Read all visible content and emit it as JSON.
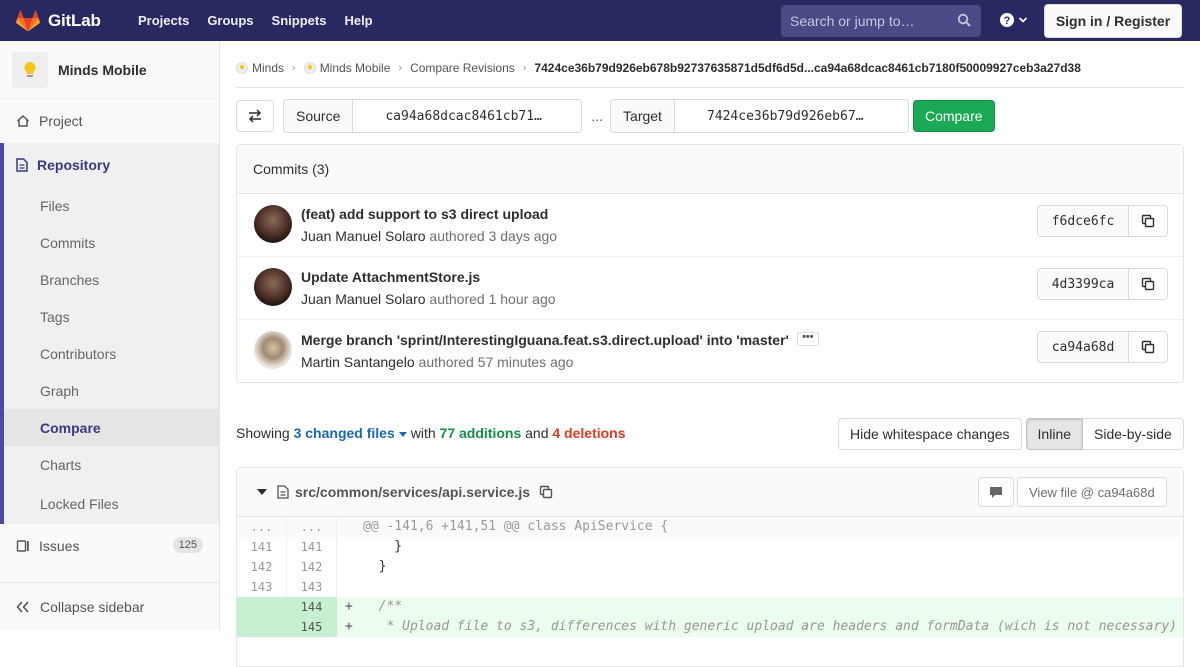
{
  "topbar": {
    "brand": "GitLab",
    "nav": [
      "Projects",
      "Groups",
      "Snippets",
      "Help"
    ],
    "search_placeholder": "Search or jump to…",
    "signin_label": "Sign in / Register",
    "brand_color": "#292961"
  },
  "sidebar": {
    "project_name": "Minds Mobile",
    "project_label": "Project",
    "repository_label": "Repository",
    "repo_items": [
      "Files",
      "Commits",
      "Branches",
      "Tags",
      "Contributors",
      "Graph",
      "Compare",
      "Charts",
      "Locked Files"
    ],
    "active_item": "Compare",
    "issues_label": "Issues",
    "issues_count": "125",
    "collapse_label": "Collapse sidebar"
  },
  "breadcrumb": {
    "items": [
      "Minds",
      "Minds Mobile",
      "Compare Revisions"
    ],
    "current": "7424ce36b79d926eb678b92737635871d5df6d5d...ca94a68dcac8461cb7180f50009927ceb3a27d38"
  },
  "compare": {
    "source_label": "Source",
    "source_value": "ca94a68dcac8461cb71…",
    "separator": "...",
    "target_label": "Target",
    "target_value": "7424ce36b79d926eb67…",
    "button_label": "Compare"
  },
  "commits": {
    "header": "Commits (3)",
    "authored_word": "authored",
    "items": [
      {
        "title": "(feat) add support to s3 direct upload",
        "author": "Juan Manuel Solaro",
        "time": "3 days ago",
        "sha": "f6dce6fc",
        "has_more": false
      },
      {
        "title": "Update AttachmentStore.js",
        "author": "Juan Manuel Solaro",
        "time": "1 hour ago",
        "sha": "4d3399ca",
        "has_more": false
      },
      {
        "title": "Merge branch 'sprint/InterestingIguana.feat.s3.direct.upload' into 'master'",
        "author": "Martin Santangelo",
        "time": "57 minutes ago",
        "sha": "ca94a68d",
        "has_more": true
      }
    ]
  },
  "summary": {
    "showing": "Showing",
    "changed_files": "3 changed files",
    "with": "with",
    "additions": "77 additions",
    "and": "and",
    "deletions": "4 deletions"
  },
  "diff_options": {
    "whitespace_label": "Hide whitespace changes",
    "inline_label": "Inline",
    "sidebyside_label": "Side-by-side"
  },
  "file": {
    "path": "src/common/services/api.service.js",
    "view_file_label": "View file @ ca94a68d",
    "lines": [
      {
        "type": "hunk",
        "old": "...",
        "new": "...",
        "sign": "",
        "text": "@@ -141,6 +141,51 @@ class ApiService {"
      },
      {
        "type": "context",
        "old": "141",
        "new": "141",
        "sign": "",
        "text": "    }"
      },
      {
        "type": "context",
        "old": "142",
        "new": "142",
        "sign": "",
        "text": "  }"
      },
      {
        "type": "context",
        "old": "143",
        "new": "143",
        "sign": "",
        "text": ""
      },
      {
        "type": "add",
        "old": "",
        "new": "144",
        "sign": "+",
        "text": "  /**"
      },
      {
        "type": "add",
        "old": "",
        "new": "145",
        "sign": "+",
        "text": "   * Upload file to s3, differences with generic upload are headers and formData (wich is not necessary)"
      }
    ]
  }
}
